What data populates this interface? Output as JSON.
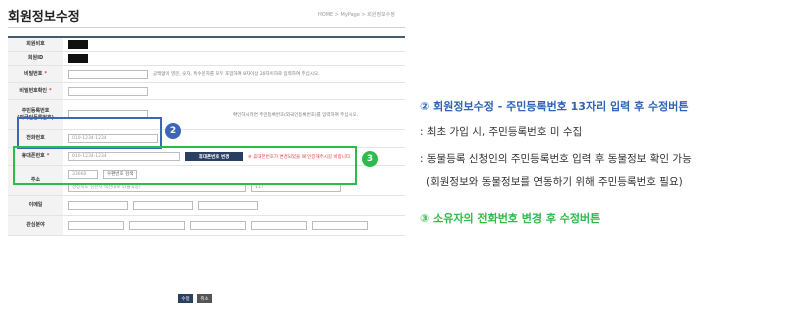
{
  "header": {
    "title": "회원정보수정",
    "breadcrumb": "HOME > MyPage > 회원정보수정"
  },
  "form": {
    "member_no_label": "회원비호",
    "member_id_label": "회원ID",
    "password_label": "비밀번호",
    "password_hint": "공백없이 영문, 숫자, 특수문자를 모두 포함하여 8자이상 20자이하로 입력하여 주십시오.",
    "password_confirm_label": "비밀번호확인",
    "rrn_label_1": "주민등록번호",
    "rrn_label_2": "(외국인등록번호)",
    "rrn_hint": "확인하시려면 주민등록번호(외국인등록번호)를 입력하여 주십시오.",
    "phone_label": "전화번호",
    "phone_value": "010-1234-1234",
    "mobile_label": "휴대폰번호",
    "mobile_value": "010-1234-1234",
    "mobile_change_button": "휴대폰번호 변경",
    "mobile_hint": "※ 휴대폰번호가 변경되었을 때 인증해주시길 바랍니다.",
    "address_label": "주소",
    "zipcode_value": "33660",
    "zipcode_search_button": "우편번호 검색",
    "address_value": "경상북도 김천시 백산대로 5(율곡동)",
    "address_detail_value": "117",
    "email_label": "이메일",
    "interest_label": "관심분야",
    "required_mark": "*"
  },
  "buttons": {
    "submit": "수정",
    "cancel": "취소"
  },
  "badges": {
    "two": "2",
    "three": "3"
  },
  "notes": {
    "title_2": "② 회원정보수정 - 주민등록번호 13자리 입력 후 수정버튼",
    "line_1": ": 최초 가입 시, 주민등록번호 미 수집",
    "line_2": ": 동물등록 신청인의 주민등록번호 입력 후 동물정보 확인 가능",
    "line_3": "(회원정보와 동물정보를 연동하기 위해 주민등록번호 필요)",
    "title_3": "③ 소유자의 전화번호 변경 후 수정버튼"
  },
  "colors": {
    "blue_highlight": "#3c66b8",
    "green_highlight": "#2dbb4a",
    "primary_button": "#2b3f63"
  }
}
